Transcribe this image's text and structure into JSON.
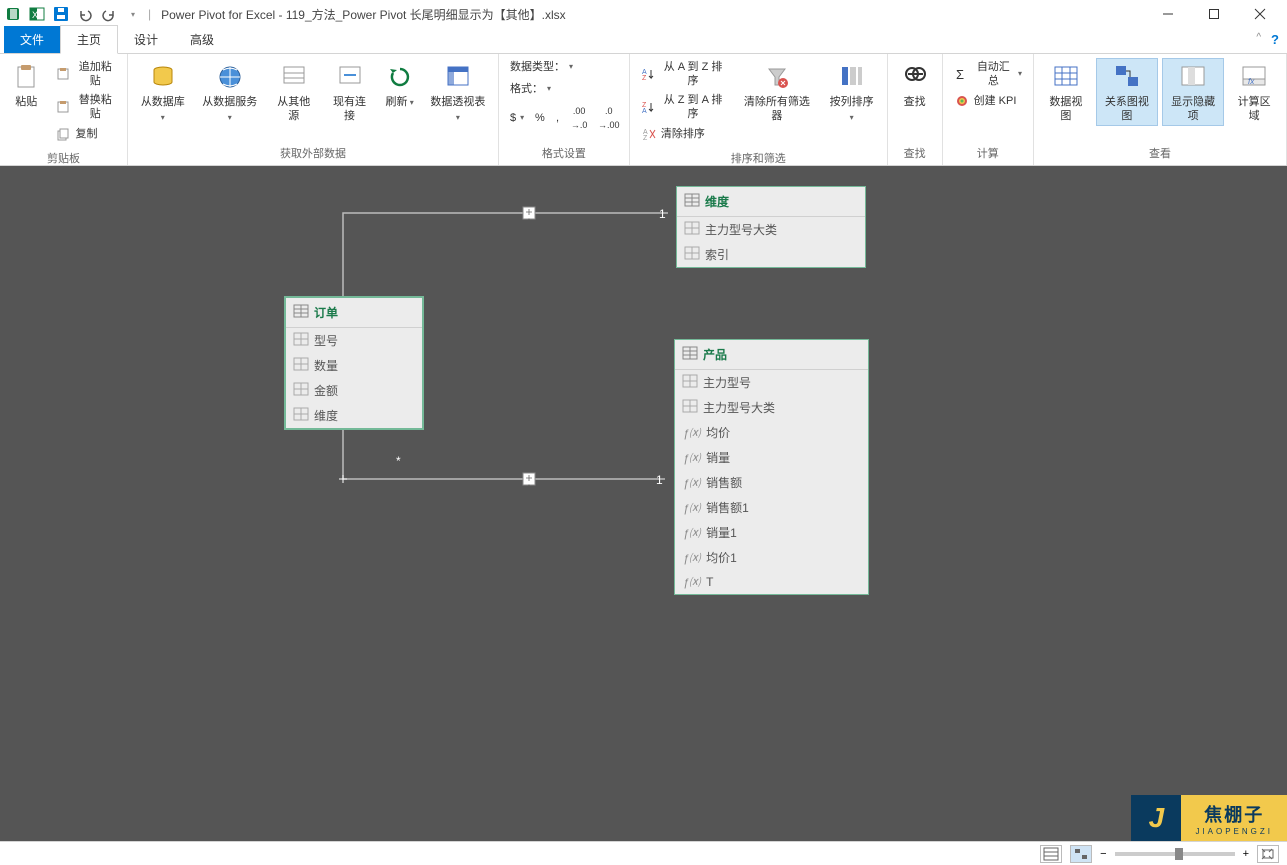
{
  "title": "Power Pivot for Excel - 119_方法_Power Pivot 长尾明细显示为【其他】.xlsx",
  "tabs": {
    "file": "文件",
    "home": "主页",
    "design": "设计",
    "advanced": "高级"
  },
  "ribbon": {
    "clipboard": {
      "label": "剪贴板",
      "paste": "粘贴",
      "append": "追加粘贴",
      "replace": "替换粘贴",
      "copy": "复制"
    },
    "getdata": {
      "label": "获取外部数据",
      "db": "从数据库",
      "svc": "从数据服务",
      "other": "从其他源",
      "existing": "现有连接",
      "refresh": "刷新",
      "pivot": "数据透视表"
    },
    "format": {
      "label": "格式设置",
      "datatype": "数据类型：",
      "fmt": "格式：",
      "currency": "$",
      "percent": "%",
      "comma": ",",
      "dec_inc": ".0←",
      "dec_dec": ".00→"
    },
    "sort": {
      "label": "排序和筛选",
      "az": "从 A 到 Z 排序",
      "za": "从 Z 到 A 排序",
      "clear": "清除排序",
      "clearall": "清除所有筛选器",
      "bycol": "按列排序"
    },
    "find": {
      "label": "查找",
      "find": "查找"
    },
    "calc": {
      "label": "计算",
      "autosum": "自动汇总",
      "kpi": "创建 KPI"
    },
    "view": {
      "label": "查看",
      "dataview": "数据视图",
      "diagview": "关系图视图",
      "hidden": "显示隐藏项",
      "calcarea": "计算区域"
    }
  },
  "diagram": {
    "t1": {
      "name": "订单",
      "cols": [
        "型号",
        "数量",
        "金额",
        "维度"
      ]
    },
    "t2": {
      "name": "维度",
      "cols": [
        "主力型号大类",
        "索引"
      ]
    },
    "t3": {
      "name": "产品",
      "cols": [
        "主力型号",
        "主力型号大类",
        "均价",
        "销量",
        "销售额",
        "销售额1",
        "销量1",
        "均价1",
        "T"
      ]
    }
  },
  "watermark": {
    "j": "J",
    "name": "焦棚子",
    "py": "JIAOPENGZI"
  }
}
